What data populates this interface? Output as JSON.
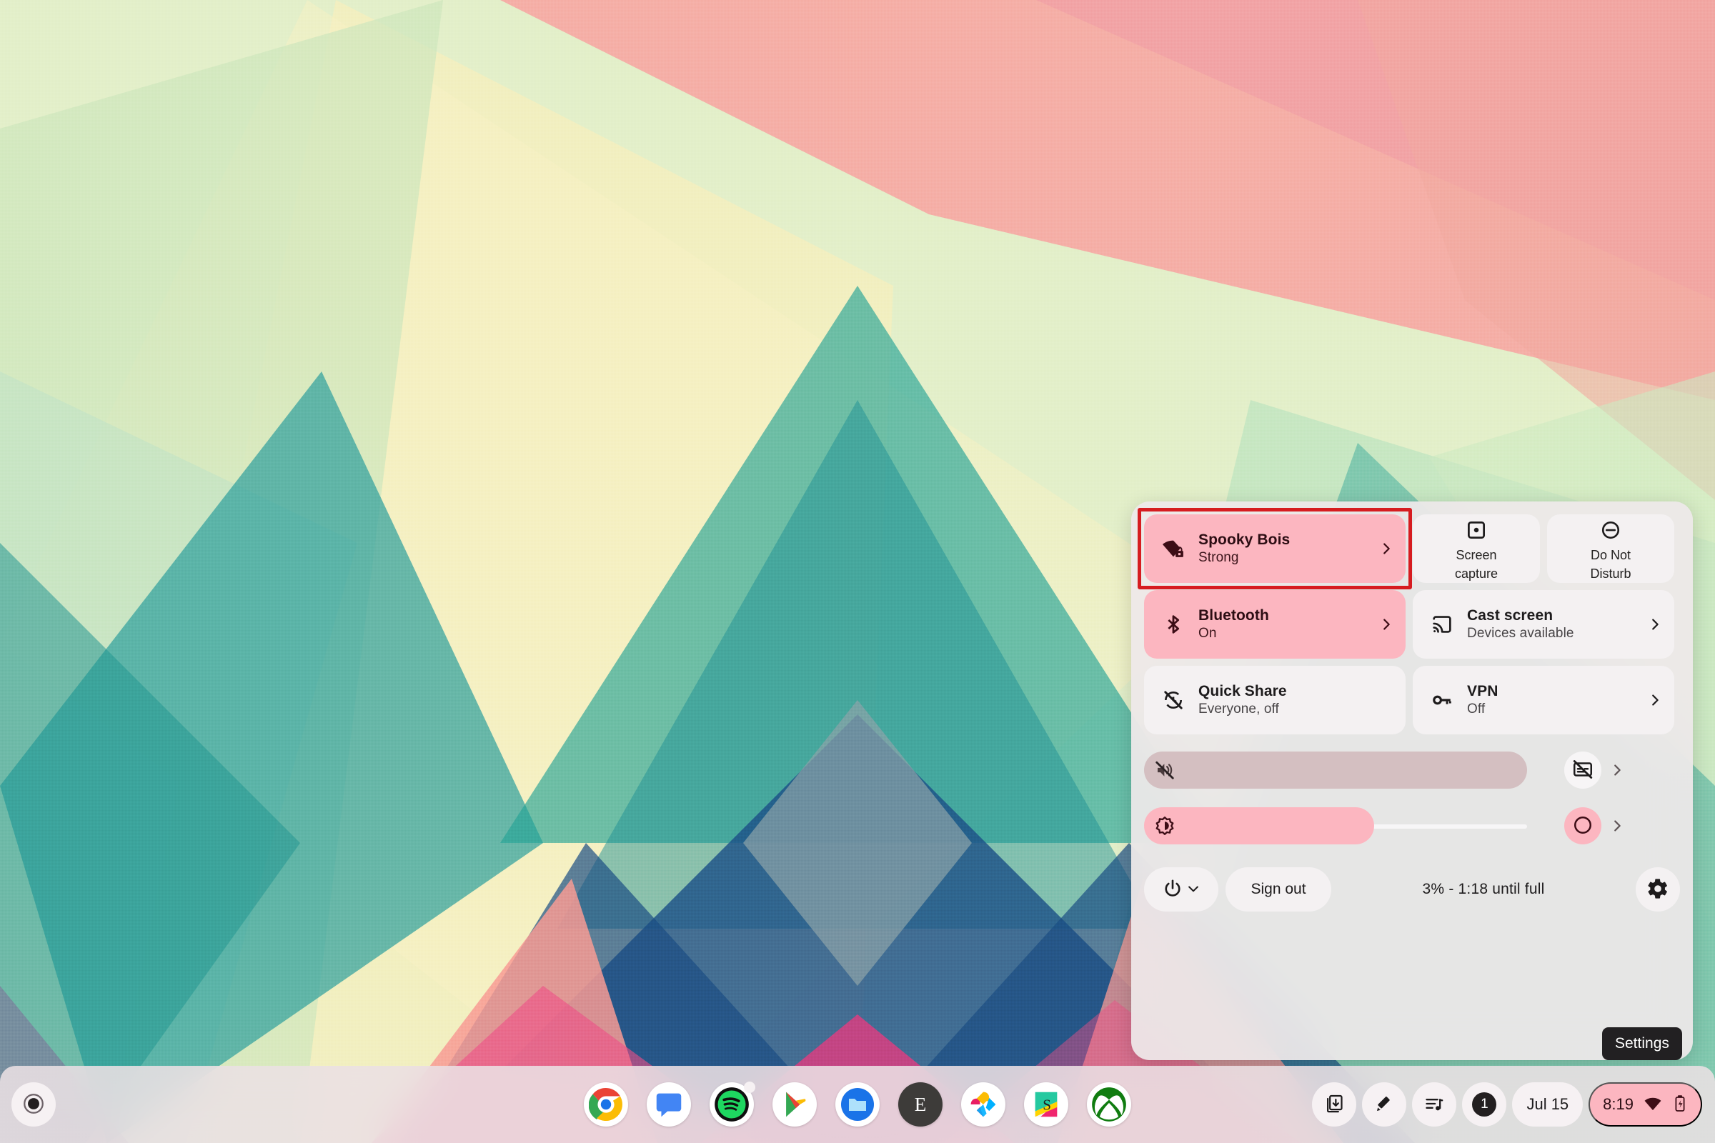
{
  "wallpaper": {
    "description": "abstract geometric pastel polygons"
  },
  "quick_settings": {
    "tiles": [
      {
        "name": "network",
        "icon": "wifi-locked-icon",
        "title": "Spooky Bois",
        "subtitle": "Strong",
        "state": "active",
        "chevron": true,
        "highlighted": true
      },
      {
        "name": "screen-capture",
        "icon": "screen-capture-icon",
        "title": "Screen capture",
        "line1": "Screen",
        "line2": "capture",
        "state": "inactive"
      },
      {
        "name": "do-not-disturb",
        "icon": "do-not-disturb-icon",
        "title": "Do Not Disturb",
        "line1": "Do Not",
        "line2": "Disturb",
        "state": "inactive"
      },
      {
        "name": "bluetooth",
        "icon": "bluetooth-icon",
        "title": "Bluetooth",
        "subtitle": "On",
        "state": "active",
        "chevron": true
      },
      {
        "name": "cast-screen",
        "icon": "cast-icon",
        "title": "Cast screen",
        "subtitle": "Devices available",
        "state": "inactive",
        "chevron": true
      },
      {
        "name": "quick-share",
        "icon": "quick-share-off-icon",
        "title": "Quick Share",
        "subtitle": "Everyone, off",
        "state": "inactive"
      },
      {
        "name": "vpn",
        "icon": "vpn-key-icon",
        "title": "VPN",
        "subtitle": "Off",
        "state": "inactive",
        "chevron": true
      }
    ],
    "volume": {
      "icon": "volume-muted-icon",
      "level_percent": 0,
      "muted": true,
      "side_icon": "live-caption-off-icon",
      "side_state": "inactive"
    },
    "brightness": {
      "icon": "brightness-icon",
      "level_percent": 60,
      "side_icon": "night-light-icon",
      "side_state": "active"
    },
    "bottom": {
      "power_icon": "power-icon",
      "power_chevron_icon": "chevron-down-icon",
      "sign_out_label": "Sign out",
      "battery_status": "3% - 1:18 until full",
      "settings_icon": "gear-icon"
    },
    "tooltip": "Settings"
  },
  "shelf": {
    "launcher": {
      "icon": "launcher-icon"
    },
    "apps": [
      {
        "name": "chrome",
        "label": "Chrome"
      },
      {
        "name": "google-chat",
        "label": "Google Chat"
      },
      {
        "name": "spotify",
        "label": "Spotify"
      },
      {
        "name": "play-store",
        "label": "Play Store"
      },
      {
        "name": "files",
        "label": "Files"
      },
      {
        "name": "e-app",
        "label": "E"
      },
      {
        "name": "photos-app",
        "label": "Photos"
      },
      {
        "name": "s-app",
        "label": "S"
      },
      {
        "name": "xbox",
        "label": "Xbox"
      }
    ],
    "tray": {
      "download_icon": "download-tray-icon",
      "stylus_icon": "stylus-pen-icon",
      "media_icon": "media-playlist-icon",
      "notification_count": "1",
      "date": "Jul 15",
      "time": "8:19",
      "network_icon": "wifi-icon",
      "battery_icon": "battery-charging-icon"
    }
  },
  "colors": {
    "accent_pink": "#fcb6c0",
    "panel_bg": "#eee8e9",
    "tile_inactive": "#f4f1f2",
    "highlight_red": "#d61c20",
    "text_dark": "#1d1b1c"
  }
}
